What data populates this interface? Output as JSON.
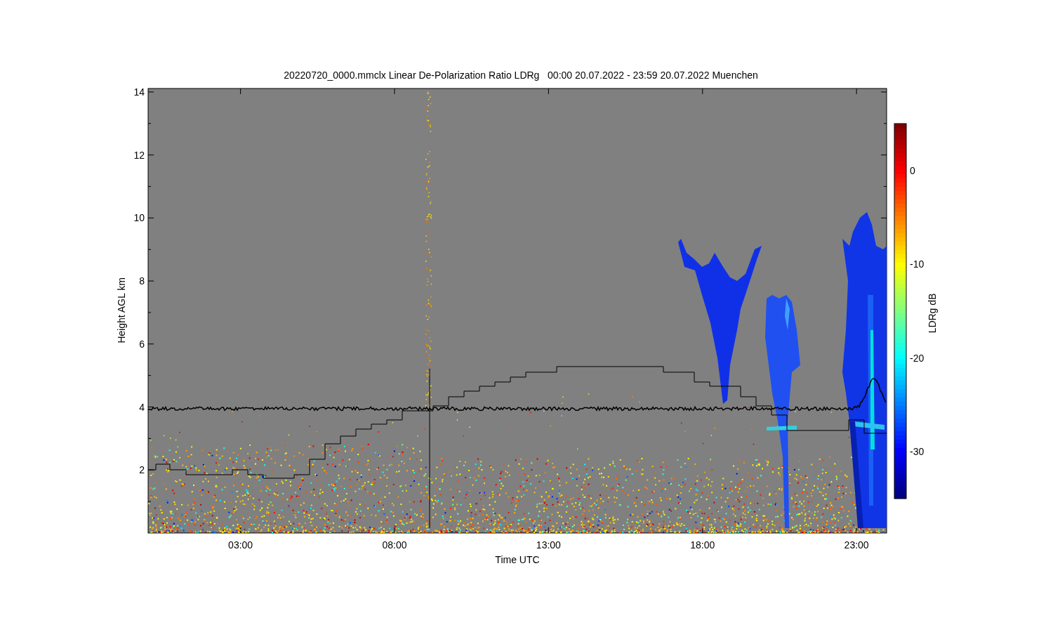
{
  "title": "20220720_0000.mmclx Linear De-Polarization Ratio LDRg   00:00 20.07.2022 - 23:59 20.07.2022 Muenchen",
  "x_axis": {
    "label": "Time UTC",
    "ticks": [
      "03:00",
      "08:00",
      "13:00",
      "18:00",
      "23:00"
    ]
  },
  "y_axis": {
    "label": "Height AGL km",
    "ticks": [
      "14",
      "12",
      "10",
      "8",
      "6",
      "4",
      "2"
    ]
  },
  "colorbar": {
    "label": "LDRg dB",
    "ticks": [
      "0",
      "-10",
      "-20",
      "-30"
    ]
  }
}
